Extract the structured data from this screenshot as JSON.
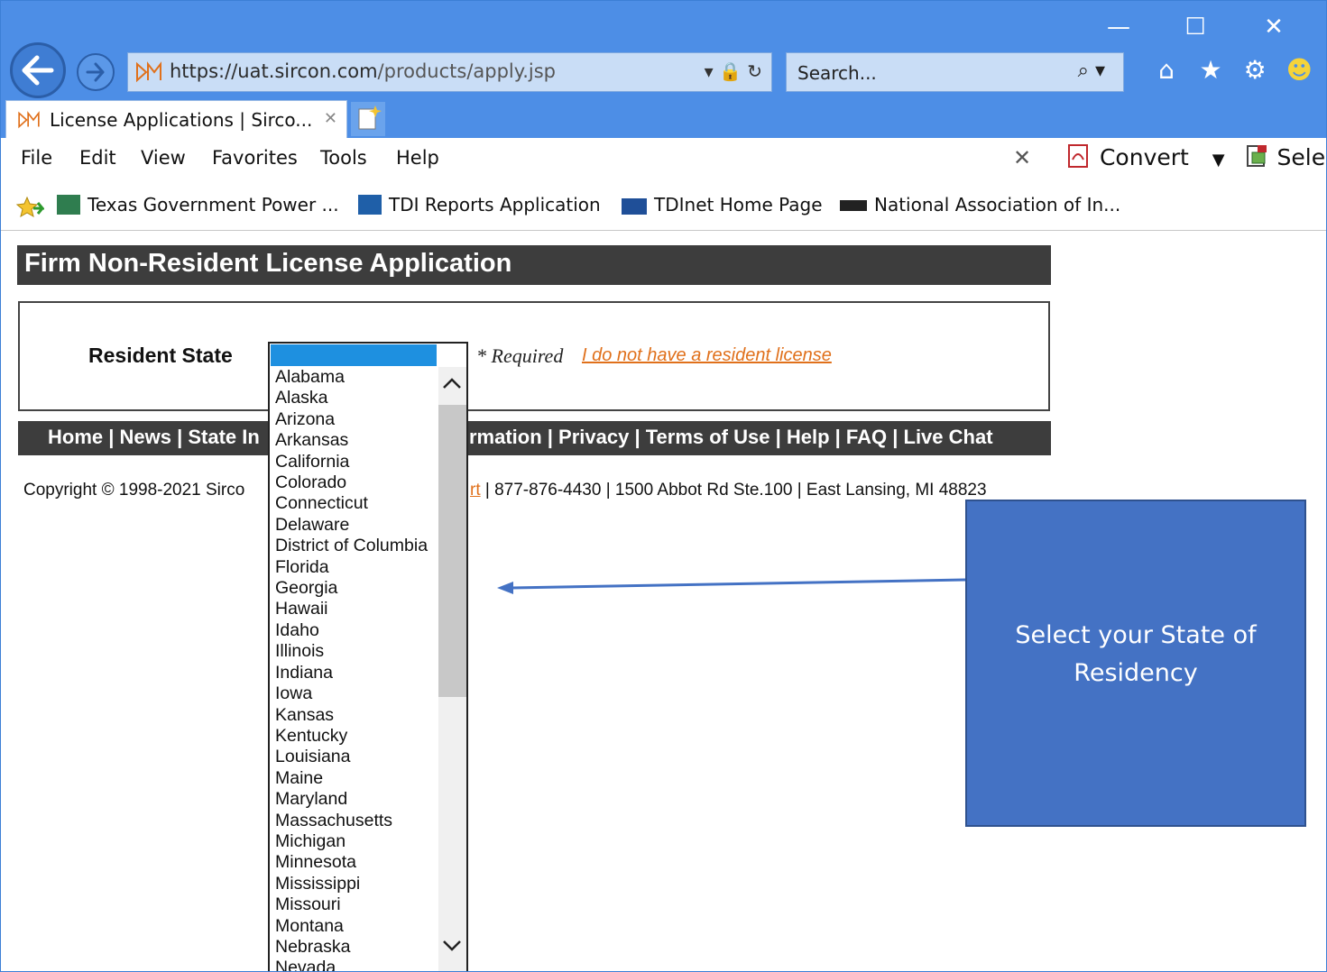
{
  "window": {
    "minimize_glyph": "—",
    "maximize_glyph": "☐",
    "close_glyph": "✕"
  },
  "address_bar": {
    "url_prefix": "https://",
    "url_domain": "uat.sircon.com",
    "url_path": "/products/apply.jsp",
    "tools": "▾ 🔒 ↻"
  },
  "search": {
    "placeholder": "Search...",
    "icon": "⌕ ▾"
  },
  "toolbar_icons": [
    "home-icon",
    "star-icon",
    "gear-icon",
    "smiley-icon"
  ],
  "tab": {
    "title": "License Applications | Sirco...",
    "close": "✕"
  },
  "menu": {
    "file": "File",
    "edit": "Edit",
    "view": "View",
    "favorites": "Favorites",
    "tools": "Tools",
    "help": "Help",
    "close_x": "✕",
    "convert": "Convert",
    "select": "Sele"
  },
  "favorites": [
    "Texas Government Power ...",
    "TDI Reports Application",
    "TDInet Home Page",
    "National Association of In..."
  ],
  "page": {
    "title": "Firm Non-Resident License Application",
    "resident_state_label": "Resident State",
    "required": "* Required",
    "no_resident_link": "I do not have a resident license",
    "nav_left": "Home | News | State In",
    "nav_right": "rmation | Privacy | Terms of Use | Help | FAQ | Live Chat",
    "copyright_left": "Copyright © 1998-2021 Sirco",
    "copyright_link": "rt",
    "copyright_right": " | 877-876-4430 | 1500 Abbot Rd Ste.100 | East Lansing, MI 48823"
  },
  "state_dropdown": {
    "selected": "",
    "options": [
      "Alabama",
      "Alaska",
      "Arizona",
      "Arkansas",
      "California",
      "Colorado",
      "Connecticut",
      "Delaware",
      "District of Columbia",
      "Florida",
      "Georgia",
      "Hawaii",
      "Idaho",
      "Illinois",
      "Indiana",
      "Iowa",
      "Kansas",
      "Kentucky",
      "Louisiana",
      "Maine",
      "Maryland",
      "Massachusetts",
      "Michigan",
      "Minnesota",
      "Mississippi",
      "Missouri",
      "Montana",
      "Nebraska",
      "Nevada"
    ]
  },
  "callout": {
    "text": "Select your State of Residency"
  },
  "colors": {
    "chrome": "#4d8ee6",
    "header_bar": "#3d3d3d",
    "link_orange": "#e0701b",
    "callout_fill": "#4472c4",
    "selection_blue": "#1e90e0"
  }
}
